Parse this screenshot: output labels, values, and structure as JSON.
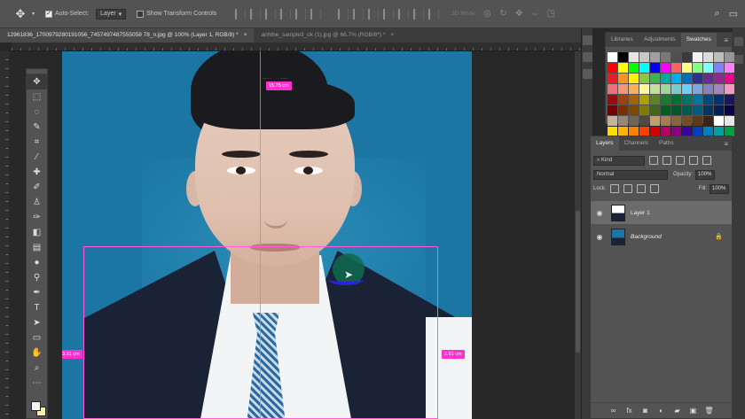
{
  "options_bar": {
    "move_tool_icon": "move-icon",
    "auto_select": {
      "label": "Auto-Select:",
      "checked": true
    },
    "auto_select_target": "Layer",
    "show_transform": {
      "label": "Show Transform Controls",
      "checked": false
    },
    "mode_3d_label": "3D Mode:"
  },
  "tabs": [
    {
      "label": "12961836_1700979280191056_7457497487555058 78_n.jpg @ 100% (Layer 1, RGB/8) *",
      "close": "×",
      "active": true
    },
    {
      "label": "anhthe_sample3_ok (1).jpg @ 66.7% (RGB/8*) *",
      "close": "×",
      "active": false
    }
  ],
  "canvas": {
    "measure_top": "15.75 cm",
    "measure_left": "3.31 cm",
    "measure_right": "2.61 cm"
  },
  "swatches_panel": {
    "tabs": [
      "Libraries",
      "Adjustments",
      "Swatches"
    ],
    "active_tab": "Swatches",
    "colors": [
      "#ffffff",
      "#000000",
      "#e6e6e6",
      "#c8c8c8",
      "#a0a0a0",
      "#787878",
      "#505050",
      "#3a3a3a",
      "#f2f2f2",
      "#dcdcdc",
      "#bebebe",
      "#969696",
      "#ff0000",
      "#ffff00",
      "#00ff00",
      "#00ffff",
      "#0000ff",
      "#ff00ff",
      "#ff6060",
      "#ffff80",
      "#80ff80",
      "#80ffff",
      "#8080ff",
      "#ff80ff",
      "#ed1c24",
      "#f7941d",
      "#fff200",
      "#8dc63f",
      "#39b54a",
      "#00a99d",
      "#00aeef",
      "#0072bc",
      "#2e3192",
      "#662d91",
      "#92278f",
      "#ec008c",
      "#f26d7d",
      "#f69679",
      "#fbaf5d",
      "#fff799",
      "#c4df9b",
      "#a3d39c",
      "#7accc8",
      "#6dcff6",
      "#7da7d9",
      "#8781bd",
      "#a187be",
      "#f49ac1",
      "#9e0b0f",
      "#a0410d",
      "#a3620a",
      "#aba000",
      "#598527",
      "#197b30",
      "#007236",
      "#00746b",
      "#0076a3",
      "#004a80",
      "#003471",
      "#1b1464",
      "#790000",
      "#7b2e00",
      "#7d4900",
      "#827b00",
      "#406618",
      "#005e20",
      "#005826",
      "#005952",
      "#005b7f",
      "#003663",
      "#002157",
      "#0d004c",
      "#c7b299",
      "#998675",
      "#736357",
      "#534741",
      "#c69c6d",
      "#a67c52",
      "#8c6239",
      "#754c24",
      "#603913",
      "#3c2415",
      "#ffffff",
      "#e6e6e6",
      "#ffdd00",
      "#ffb300",
      "#ff7f00",
      "#ff4000",
      "#d40000",
      "#b80063",
      "#8a0080",
      "#3c00a0",
      "#0040c0",
      "#0080c0",
      "#00a0a0",
      "#00a040"
    ]
  },
  "layers_panel": {
    "tabs": [
      "Layers",
      "Channels",
      "Paths"
    ],
    "active_tab": "Layers",
    "kind_label": "Kind",
    "blend_mode": "Normal",
    "opacity_label": "Opacity:",
    "opacity_value": "100%",
    "lock_label": "Lock:",
    "fill_label": "Fill:",
    "fill_value": "100%",
    "layers": [
      {
        "name": "Layer 1",
        "selected": true,
        "visible": true
      },
      {
        "name": "Background",
        "selected": false,
        "visible": true,
        "locked": true
      }
    ]
  }
}
